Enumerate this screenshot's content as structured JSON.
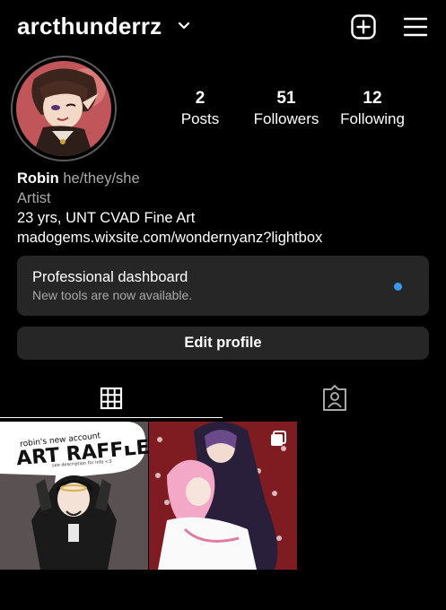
{
  "header": {
    "username": "arcthunderrz",
    "icons": [
      "chevron-down-icon",
      "new-post-icon",
      "menu-icon"
    ]
  },
  "stats": [
    {
      "count": "2",
      "label": "Posts"
    },
    {
      "count": "51",
      "label": "Followers"
    },
    {
      "count": "12",
      "label": "Following"
    }
  ],
  "bio": {
    "name": "Robin",
    "pronouns": "he/they/she",
    "category": "Artist",
    "line": "23 yrs, UNT CVAD Fine Art",
    "link": "madogems.wixsite.com/wondernyanz?lightbox"
  },
  "dashboard": {
    "title": "Professional dashboard",
    "subtitle": "New tools are now available.",
    "dot_color": "#3897f0"
  },
  "edit_profile": "Edit profile",
  "tabs": [
    "grid-icon",
    "tagged-icon"
  ],
  "posts": [
    {
      "caption_top": "robin's new account",
      "caption_main": "ART RAFFLE!!",
      "caption_small": "see description for info <3"
    },
    {}
  ]
}
